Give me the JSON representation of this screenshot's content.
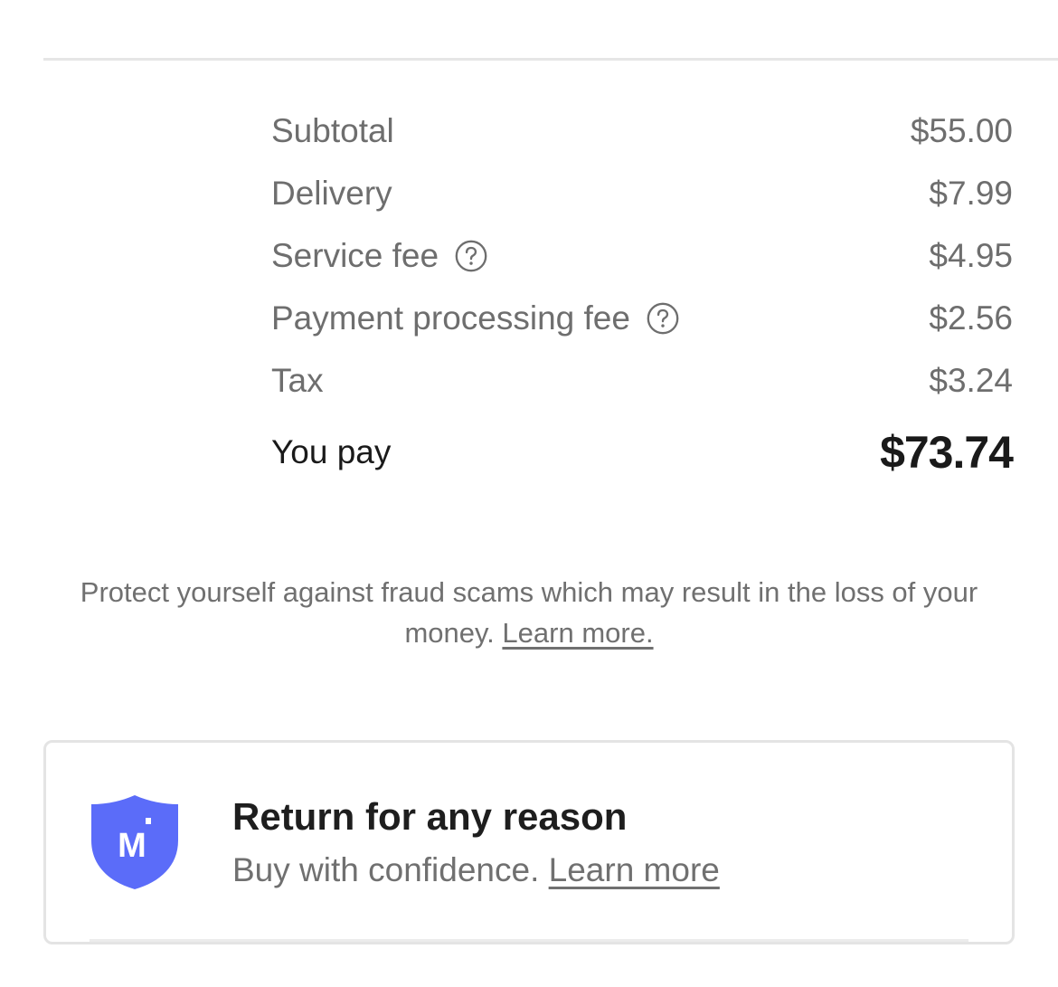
{
  "summary": {
    "rows": [
      {
        "label": "Subtotal",
        "amount": "$55.00",
        "help": false
      },
      {
        "label": "Delivery",
        "amount": "$7.99",
        "help": false
      },
      {
        "label": "Service fee",
        "amount": "$4.95",
        "help": true
      },
      {
        "label": "Payment processing fee",
        "amount": "$2.56",
        "help": true
      },
      {
        "label": "Tax",
        "amount": "$3.24",
        "help": false
      }
    ],
    "total": {
      "label": "You pay",
      "amount": "$73.74"
    }
  },
  "notice": {
    "text": "Protect yourself against fraud scams which may result in the loss of your money. ",
    "link": "Learn more."
  },
  "guarantee": {
    "icon": "shield-m-icon",
    "icon_letter": "M",
    "title": "Return for any reason",
    "subtitle": "Buy with confidence. ",
    "link": "Learn more",
    "accent": "#5b6cf9"
  },
  "icons": {
    "help": "question-circle-icon"
  }
}
